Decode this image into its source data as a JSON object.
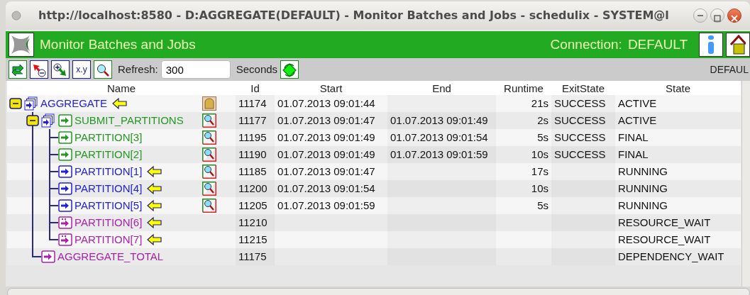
{
  "window": {
    "title": "http://localhost:8580 - D:AGGREGATE(DEFAULT) - Monitor Batches and Jobs - schedulix - SYSTEM@l"
  },
  "header": {
    "title": "Monitor Batches and Jobs",
    "connection_label": "Connection:",
    "connection": "DEFAULT"
  },
  "toolbar": {
    "format_button": "x.y",
    "refresh_label": "Refresh:",
    "refresh_value": "300",
    "seconds_label": "Seconds",
    "server": "DEFAUL"
  },
  "table": {
    "columns": [
      "Name",
      "Id",
      "Start",
      "End",
      "Runtime",
      "ExitState",
      "State"
    ],
    "rows": [
      {
        "name": "AGGREGATE",
        "kind": "batch",
        "color": "#2222dd",
        "expanded": true,
        "pointer": true,
        "badge": {
          "kind": "rip"
        },
        "id": "11174",
        "start": "01.07.2013 09:01:44",
        "runtime": "21s",
        "exit_state": "SUCCESS",
        "state": "ACTIVE",
        "children": [
          {
            "name": "SUBMIT_PARTITIONS",
            "kind": "parent_job",
            "color": "#229922",
            "expanded": true,
            "pointer": false,
            "badge": {
              "kind": "log"
            },
            "id": "11177",
            "start": "01.07.2013 09:01:47",
            "end": "01.07.2013 09:01:49",
            "runtime": "2s",
            "exit_state": "SUCCESS",
            "state": "ACTIVE",
            "children": [
              {
                "name": "PARTITION[3]",
                "kind": "job",
                "color": "#229922",
                "pointer": false,
                "badge": {
                  "kind": "log"
                },
                "id": "11195",
                "start": "01.07.2013 09:01:49",
                "end": "01.07.2013 09:01:54",
                "runtime": "5s",
                "exit_state": "SUCCESS",
                "state": "FINAL"
              },
              {
                "name": "PARTITION[2]",
                "kind": "job",
                "color": "#229922",
                "pointer": false,
                "badge": {
                  "kind": "log"
                },
                "id": "11190",
                "start": "01.07.2013 09:01:49",
                "end": "01.07.2013 09:01:59",
                "runtime": "10s",
                "exit_state": "SUCCESS",
                "state": "FINAL"
              },
              {
                "name": "PARTITION[1]",
                "kind": "job",
                "color": "#2222dd",
                "pointer": true,
                "badge": {
                  "kind": "log"
                },
                "id": "11185",
                "start": "01.07.2013 09:01:47",
                "runtime": "17s",
                "state": "RUNNING"
              },
              {
                "name": "PARTITION[4]",
                "kind": "job",
                "color": "#2222dd",
                "pointer": true,
                "badge": {
                  "kind": "log"
                },
                "id": "11200",
                "start": "01.07.2013 09:01:54",
                "runtime": "10s",
                "state": "RUNNING"
              },
              {
                "name": "PARTITION[5]",
                "kind": "job",
                "color": "#2222dd",
                "pointer": true,
                "badge": {
                  "kind": "log"
                },
                "id": "11205",
                "start": "01.07.2013 09:01:59",
                "runtime": "5s",
                "state": "RUNNING"
              },
              {
                "name": "PARTITION[6]",
                "kind": "waiting_job",
                "color": "#aa22aa",
                "pointer": true,
                "id": "11210",
                "state": "RESOURCE_WAIT"
              },
              {
                "name": "PARTITION[7]",
                "kind": "waiting_job",
                "color": "#aa22aa",
                "pointer": true,
                "id": "11215",
                "state": "RESOURCE_WAIT"
              }
            ]
          },
          {
            "name": "AGGREGATE_TOTAL",
            "kind": "job",
            "color": "#aa22aa",
            "pointer": false,
            "id": "11175",
            "state": "DEPENDENCY_WAIT"
          }
        ]
      }
    ]
  }
}
